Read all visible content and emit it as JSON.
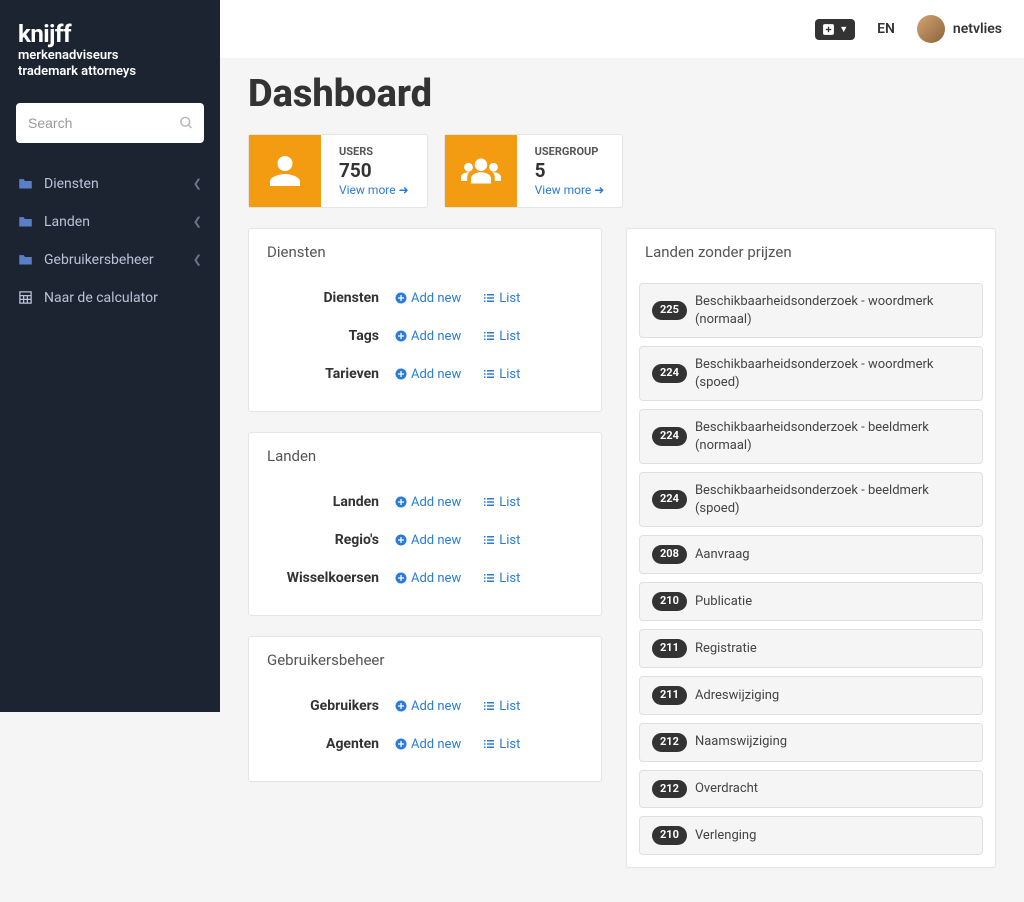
{
  "brand": {
    "main": "knijff",
    "sub1": "merkenadviseurs",
    "sub2": "trademark attorneys"
  },
  "search": {
    "placeholder": "Search"
  },
  "nav": {
    "items": [
      {
        "label": "Diensten",
        "hasChildren": true
      },
      {
        "label": "Landen",
        "hasChildren": true
      },
      {
        "label": "Gebruikersbeheer",
        "hasChildren": true
      },
      {
        "label": "Naar de calculator",
        "hasChildren": false
      }
    ]
  },
  "topbar": {
    "lang": "EN",
    "user": "netvlies"
  },
  "page": {
    "title": "Dashboard"
  },
  "stats": [
    {
      "label": "USERS",
      "value": "750",
      "link": "View more"
    },
    {
      "label": "USERGROUP",
      "value": "5",
      "link": "View more"
    }
  ],
  "panels": {
    "diensten": {
      "title": "Diensten",
      "rows": [
        {
          "label": "Diensten",
          "add": "Add new",
          "list": "List"
        },
        {
          "label": "Tags",
          "add": "Add new",
          "list": "List"
        },
        {
          "label": "Tarieven",
          "add": "Add new",
          "list": "List"
        }
      ]
    },
    "landen": {
      "title": "Landen",
      "rows": [
        {
          "label": "Landen",
          "add": "Add new",
          "list": "List"
        },
        {
          "label": "Regio's",
          "add": "Add new",
          "list": "List"
        },
        {
          "label": "Wisselkoersen",
          "add": "Add new",
          "list": "List"
        }
      ]
    },
    "gebruikers": {
      "title": "Gebruikersbeheer",
      "rows": [
        {
          "label": "Gebruikers",
          "add": "Add new",
          "list": "List"
        },
        {
          "label": "Agenten",
          "add": "Add new",
          "list": "List"
        }
      ]
    },
    "prijzen": {
      "title": "Landen zonder prijzen",
      "items": [
        {
          "count": "225",
          "label": "Beschikbaarheidsonderzoek - woordmerk (normaal)"
        },
        {
          "count": "224",
          "label": "Beschikbaarheidsonderzoek - woordmerk (spoed)"
        },
        {
          "count": "224",
          "label": "Beschikbaarheidsonderzoek - beeldmerk (normaal)"
        },
        {
          "count": "224",
          "label": "Beschikbaarheidsonderzoek - beeldmerk (spoed)"
        },
        {
          "count": "208",
          "label": "Aanvraag"
        },
        {
          "count": "210",
          "label": "Publicatie"
        },
        {
          "count": "211",
          "label": "Registratie"
        },
        {
          "count": "211",
          "label": "Adreswijziging"
        },
        {
          "count": "212",
          "label": "Naamswijziging"
        },
        {
          "count": "212",
          "label": "Overdracht"
        },
        {
          "count": "210",
          "label": "Verlenging"
        }
      ]
    }
  }
}
